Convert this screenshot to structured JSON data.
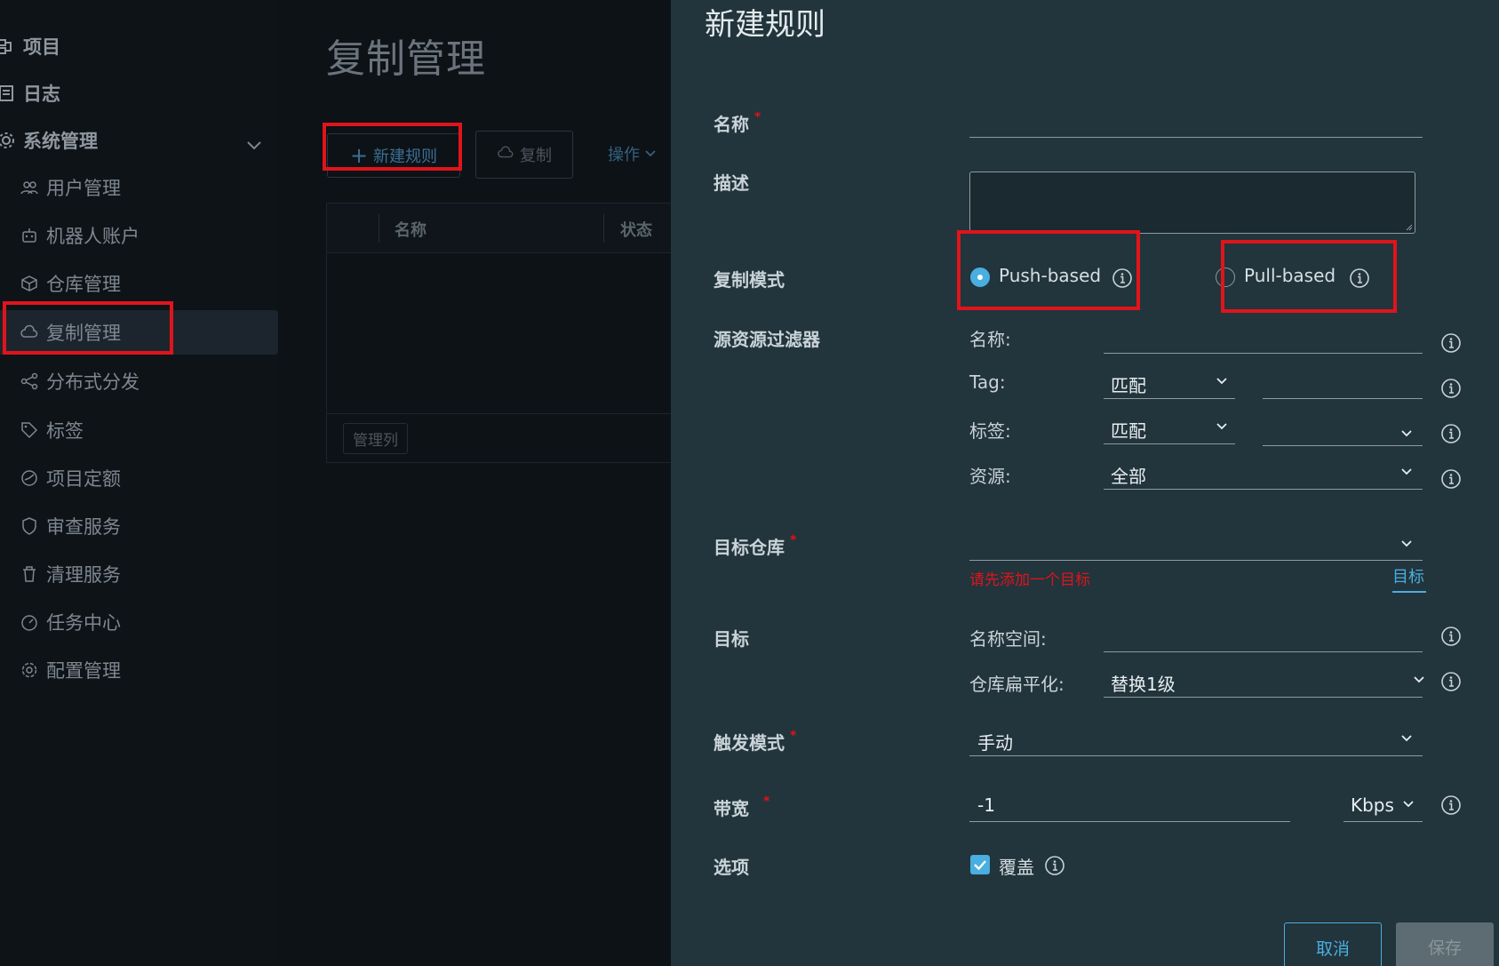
{
  "sidebar": {
    "items": [
      {
        "label": "项目",
        "icon": "project-icon"
      },
      {
        "label": "日志",
        "icon": "log-icon"
      },
      {
        "label": "系统管理",
        "icon": "system-admin-icon"
      },
      {
        "label": "用户管理",
        "icon": "users-icon"
      },
      {
        "label": "机器人账户",
        "icon": "robot-icon"
      },
      {
        "label": "仓库管理",
        "icon": "registry-icon"
      },
      {
        "label": "复制管理",
        "icon": "cloud-sync-icon"
      },
      {
        "label": "分布式分发",
        "icon": "share-icon"
      },
      {
        "label": "标签",
        "icon": "tag-icon"
      },
      {
        "label": "项目定额",
        "icon": "quota-icon"
      },
      {
        "label": "审查服务",
        "icon": "shield-icon"
      },
      {
        "label": "清理服务",
        "icon": "trash-icon"
      },
      {
        "label": "任务中心",
        "icon": "dashboard-icon"
      },
      {
        "label": "配置管理",
        "icon": "gear-icon"
      }
    ]
  },
  "main": {
    "title": "复制管理",
    "new_rule_label": "新建规则",
    "copy_label": "复制",
    "ops_label": "操作",
    "columns": [
      "名称",
      "状态"
    ],
    "manage_columns_label": "管理列"
  },
  "form": {
    "title": "新建规则",
    "name_label": "名称",
    "desc_label": "描述",
    "mode_label": "复制模式",
    "push_label": "Push-based",
    "pull_label": "Pull-based",
    "mode_selected": "Push-based",
    "filter_label": "源资源过滤器",
    "filter_name_label": "名称:",
    "filter_tag_label": "Tag:",
    "filter_tag_value": "匹配",
    "filter_labels_label": "标签:",
    "filter_labels_value": "匹配",
    "filter_resource_label": "资源:",
    "filter_resource_value": "全部",
    "target_registry_label": "目标仓库",
    "target_error": "请先添加一个目标",
    "target_link": "目标",
    "dest_label": "目标",
    "namespace_label": "名称空间:",
    "flatten_label": "仓库扁平化:",
    "flatten_value": "替换1级",
    "trigger_label": "触发模式",
    "trigger_value": "手动",
    "bandwidth_label": "带宽",
    "bandwidth_value": "-1",
    "bandwidth_unit": "Kbps",
    "options_label": "选项",
    "override_label": "覆盖",
    "override_checked": true,
    "cancel_label": "取消",
    "save_label": "保存"
  },
  "colors": {
    "panel_bg": "#22343c",
    "accent": "#49aee0",
    "error": "#e0141b",
    "highlight_box": "#e0141b"
  }
}
